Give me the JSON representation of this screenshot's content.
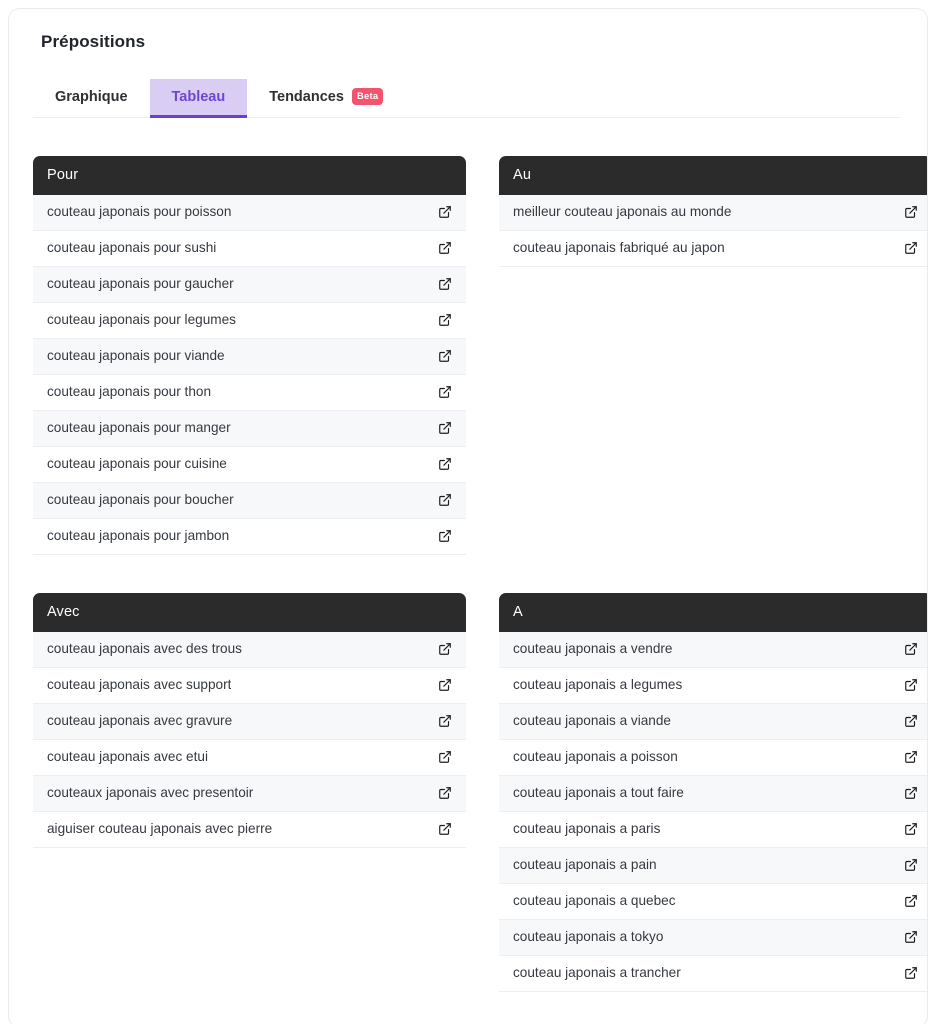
{
  "card": {
    "title": "Prépositions"
  },
  "tabs": [
    {
      "label": "Graphique",
      "active": false,
      "badge": null
    },
    {
      "label": "Tableau",
      "active": true,
      "badge": null
    },
    {
      "label": "Tendances",
      "active": false,
      "badge": "Beta"
    }
  ],
  "icons": {
    "external_link": "external-link-icon"
  },
  "colors": {
    "tab_active_bg": "#d9cdf3",
    "tab_active_text": "#7046d4",
    "tab_underline": "#6d3fd1",
    "badge_bg": "#f2536f",
    "table_header_bg": "#2b2b2b",
    "row_alt_bg": "#f7f8fa",
    "row_text": "#353a40",
    "card_border": "#ebe9f2"
  },
  "tables": [
    {
      "header": "Pour",
      "rows": [
        "couteau japonais pour poisson",
        "couteau japonais pour sushi",
        "couteau japonais pour gaucher",
        "couteau japonais pour legumes",
        "couteau japonais pour viande",
        "couteau japonais pour thon",
        "couteau japonais pour manger",
        "couteau japonais pour cuisine",
        "couteau japonais pour boucher",
        "couteau japonais pour jambon"
      ]
    },
    {
      "header": "Au",
      "rows": [
        "meilleur couteau japonais au monde",
        "couteau japonais fabriqué au japon"
      ]
    },
    {
      "header": "Avec",
      "rows": [
        "couteau japonais avec des trous",
        "couteau japonais avec support",
        "couteau japonais avec gravure",
        "couteau japonais avec etui",
        "couteaux japonais avec presentoir",
        "aiguiser couteau japonais avec pierre"
      ]
    },
    {
      "header": "A",
      "rows": [
        "couteau japonais a vendre",
        "couteau japonais a legumes",
        "couteau japonais a viande",
        "couteau japonais a poisson",
        "couteau japonais a tout faire",
        "couteau japonais a paris",
        "couteau japonais a pain",
        "couteau japonais a quebec",
        "couteau japonais a tokyo",
        "couteau japonais a trancher"
      ]
    }
  ]
}
